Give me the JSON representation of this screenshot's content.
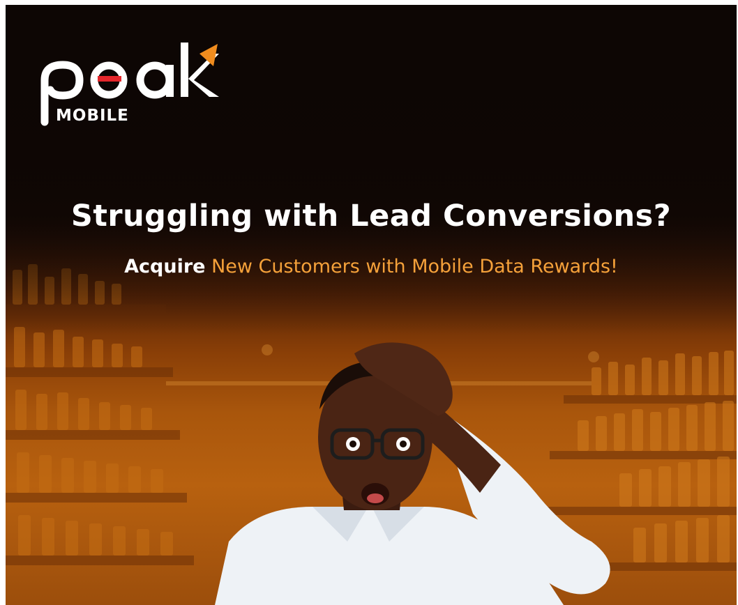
{
  "brand": {
    "logo_text": "peak",
    "logo_subtext": "MOBILE",
    "accent_color": "#f08c1e",
    "dot_color": "#e5262b"
  },
  "hero": {
    "headline": "Struggling with Lead Conversions?",
    "subhead_strong": "Acquire",
    "subhead_accent": "New Customers with Mobile Data Rewards!",
    "accent_color": "#f5a13a"
  },
  "image": {
    "subject": "surprised-man-with-glasses-in-store-aisle"
  }
}
